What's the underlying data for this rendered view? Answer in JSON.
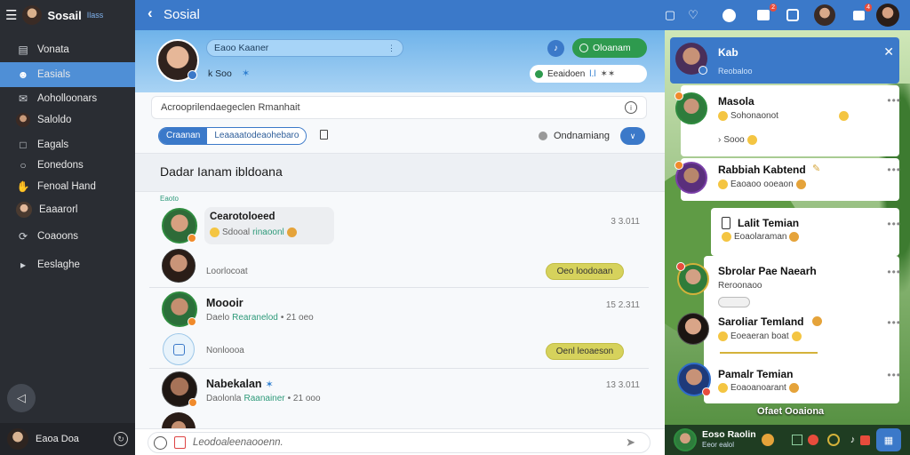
{
  "app": {
    "title": "Sosail",
    "title_suffix": "Ilass"
  },
  "sidebar": {
    "items": [
      {
        "label": "Vonata",
        "icon": "book-icon"
      },
      {
        "label": "Easials",
        "icon": "users-icon",
        "active": true
      },
      {
        "label": "Aoholloonars",
        "icon": "chat-icon"
      },
      {
        "label": "Saloldo",
        "icon": "avatar-icon"
      },
      {
        "label": "Eagals",
        "icon": "document-icon"
      },
      {
        "label": "Eonedons",
        "icon": "globe-icon"
      },
      {
        "label": "Fenoal Hand",
        "icon": "hand-icon"
      },
      {
        "label": "Eaaarorl",
        "icon": "avatar-icon"
      },
      {
        "label": "Coaoons",
        "icon": "refresh-icon"
      },
      {
        "label": "Eeslaghe",
        "icon": "megaphone-icon"
      }
    ],
    "fab_icon": "megaphone-icon",
    "footer_label": "Eaoa Doa"
  },
  "topbar": {
    "title": "Sosial",
    "notification_counts": [
      "2",
      "4"
    ]
  },
  "profile": {
    "name_field": "Eaoo Kaaner",
    "handle": "k Soo",
    "primary_button": "Oloanam",
    "secondary_label": "Eeaidoen",
    "secondary_value": "l.l",
    "secondary_tag": "✶✶"
  },
  "main": {
    "search_placeholder": "Acrooprilendaegeclen Rmanhait",
    "segment_left": "Craanan",
    "segment_right": "Leaaaatodeaohebaro",
    "filter_label": "Ondnamiang",
    "section_title": "Dadar Ianam ibldoana",
    "small_tag": "Eaoto",
    "feed": [
      {
        "name": "Cearotoloeed",
        "sub_a": "Sdooal",
        "sub_b": "rinaoonl",
        "time": "3 3.011"
      },
      {
        "name": "",
        "sub_a": "Loorlocoat",
        "button": "Oeo loodoaan"
      },
      {
        "name": "Moooir",
        "sub_a": "Daelo ",
        "sub_b": "Rearanelod",
        "sub_c": "• 21 oeo",
        "time": "15 2.311"
      },
      {
        "name": "",
        "sub_a": "Nonloooa",
        "button": "Oenl leoaeson"
      },
      {
        "name": "Nabekalan",
        "sub_a": "Daolonla ",
        "sub_b": "Raanainer",
        "sub_c": "• 21 ooo",
        "time": "13 3.011"
      }
    ],
    "composer_placeholder": "Leodoaleenaooenn."
  },
  "right_panel": {
    "header_title": "Kab",
    "header_sub": "Reobaloo",
    "contacts": [
      {
        "name": "Masola",
        "line1": "Sohonaonot",
        "line2": "Sooo"
      },
      {
        "name": "Rabbiah Kabtend",
        "line1": "Eaoaoo ooeaon"
      },
      {
        "name": "Lalit Temian",
        "line1": "Eoaolaraman"
      },
      {
        "name": "Sbrolar Pae Naearh",
        "line1": "Reroonaoo"
      },
      {
        "name": "Saroliar Temland",
        "line1": "Eoeaeran boat"
      },
      {
        "name": "Pamalr Temian",
        "line1": "Eoaoanoarant"
      }
    ],
    "banner": "Ofaet Ooaiona",
    "footer_name": "Eoso Raolin",
    "footer_sub": "Eeor ealol"
  },
  "colors": {
    "brand": "#3b79c9",
    "accent_green": "#2e9a4e",
    "sidebar": "#2a2d33",
    "active": "#4f8fd6",
    "button_yellow": "#d6d25c"
  }
}
